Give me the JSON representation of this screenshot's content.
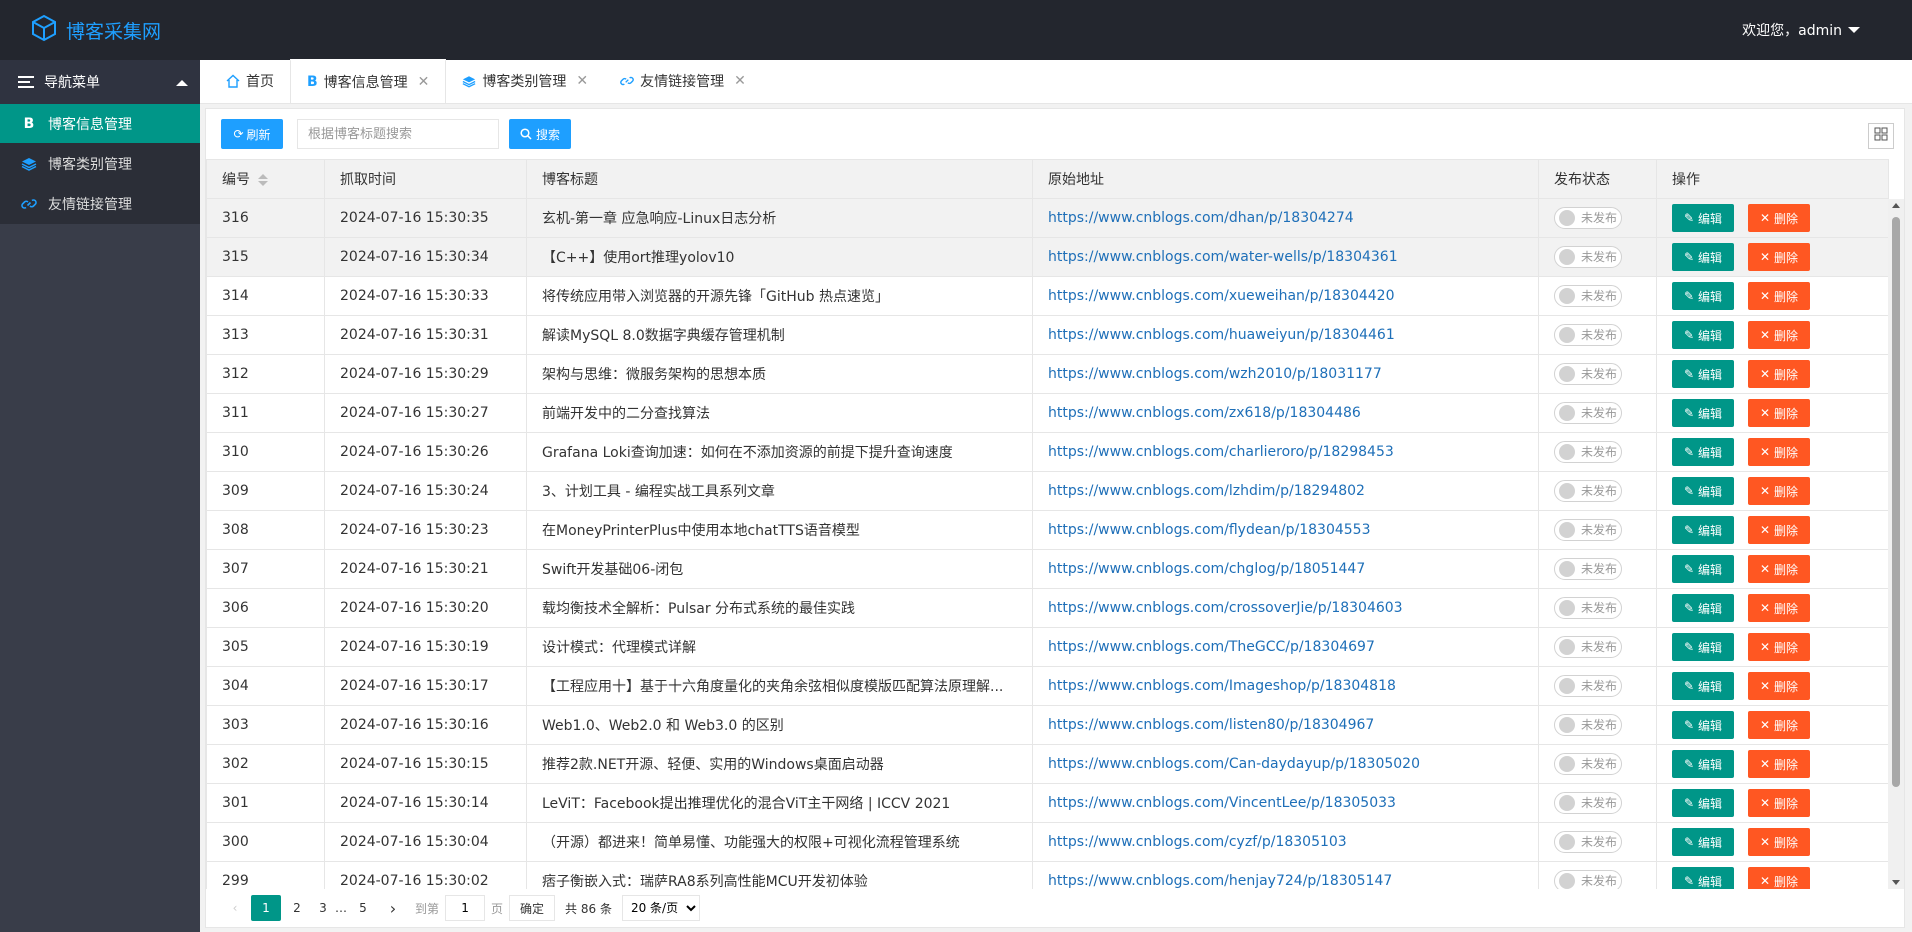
{
  "app": {
    "title": "博客采集网"
  },
  "user": {
    "greeting": "欢迎您，admin"
  },
  "sidebar": {
    "header": "导航菜单",
    "items": [
      {
        "icon": "b-letter-icon",
        "label": "博客信息管理",
        "active": true
      },
      {
        "icon": "layers-icon",
        "label": "博客类别管理",
        "active": false
      },
      {
        "icon": "link-icon",
        "label": "友情链接管理",
        "active": false
      }
    ]
  },
  "tabs": [
    {
      "label": "首页",
      "closable": false
    },
    {
      "label": "博客信息管理",
      "closable": true,
      "active": true
    },
    {
      "label": "博客类别管理",
      "closable": true
    },
    {
      "label": "友情链接管理",
      "closable": true
    }
  ],
  "toolbar": {
    "refresh_label": "刷新",
    "search_placeholder": "根据博客标题搜索",
    "search_label": "搜索"
  },
  "table": {
    "columns": [
      "编号",
      "抓取时间",
      "博客标题",
      "原始地址",
      "发布状态",
      "操作"
    ],
    "status_label": "未发布",
    "edit_label": "编辑",
    "delete_label": "删除",
    "rows": [
      [
        "316",
        "2024-07-16 15:30:35",
        "玄机-第一章 应急响应-Linux日志分析",
        "https://www.cnblogs.com/dhan/p/18304274"
      ],
      [
        "315",
        "2024-07-16 15:30:34",
        "【C++】使用ort推理yolov10",
        "https://www.cnblogs.com/water-wells/p/18304361"
      ],
      [
        "314",
        "2024-07-16 15:30:33",
        "将传统应用带入浏览器的开源先锋「GitHub 热点速览」",
        "https://www.cnblogs.com/xueweihan/p/18304420"
      ],
      [
        "313",
        "2024-07-16 15:30:31",
        "解读MySQL 8.0数据字典缓存管理机制",
        "https://www.cnblogs.com/huaweiyun/p/18304461"
      ],
      [
        "312",
        "2024-07-16 15:30:29",
        "架构与思维：微服务架构的思想本质",
        "https://www.cnblogs.com/wzh2010/p/18031177"
      ],
      [
        "311",
        "2024-07-16 15:30:27",
        "前端开发中的二分查找算法",
        "https://www.cnblogs.com/zx618/p/18304486"
      ],
      [
        "310",
        "2024-07-16 15:30:26",
        "Grafana Loki查询加速：如何在不添加资源的前提下提升查询速度",
        "https://www.cnblogs.com/charlieroro/p/18298453"
      ],
      [
        "309",
        "2024-07-16 15:30:24",
        "3、计划工具 - 编程实战工具系列文章",
        "https://www.cnblogs.com/lzhdim/p/18294802"
      ],
      [
        "308",
        "2024-07-16 15:30:23",
        "在MoneyPrinterPlus中使用本地chatTTS语音模型",
        "https://www.cnblogs.com/flydean/p/18304553"
      ],
      [
        "307",
        "2024-07-16 15:30:21",
        "Swift开发基础06-闭包",
        "https://www.cnblogs.com/chglog/p/18051447"
      ],
      [
        "306",
        "2024-07-16 15:30:20",
        "载均衡技术全解析：Pulsar 分布式系统的最佳实践",
        "https://www.cnblogs.com/crossoverJie/p/18304603"
      ],
      [
        "305",
        "2024-07-16 15:30:19",
        "设计模式：代理模式详解",
        "https://www.cnblogs.com/TheGCC/p/18304697"
      ],
      [
        "304",
        "2024-07-16 15:30:17",
        "【工程应用十】基于十六角度量化的夹角余弦相似度模版匹配算法原理解...",
        "https://www.cnblogs.com/Imageshop/p/18304818"
      ],
      [
        "303",
        "2024-07-16 15:30:16",
        "Web1.0、Web2.0 和 Web3.0 的区别",
        "https://www.cnblogs.com/listen80/p/18304967"
      ],
      [
        "302",
        "2024-07-16 15:30:15",
        "推荐2款.NET开源、轻便、实用的Windows桌面启动器",
        "https://www.cnblogs.com/Can-daydayup/p/18305020"
      ],
      [
        "301",
        "2024-07-16 15:30:14",
        "LeViT：Facebook提出推理优化的混合ViT主干网络 | ICCV 2021",
        "https://www.cnblogs.com/VincentLee/p/18305033"
      ],
      [
        "300",
        "2024-07-16 15:30:04",
        "（开源）都进来！简单易懂、功能强大的权限+可视化流程管理系统",
        "https://www.cnblogs.com/cyzf/p/18305103"
      ],
      [
        "299",
        "2024-07-16 15:30:02",
        "痞子衡嵌入式：瑞萨RA8系列高性能MCU开发初体验",
        "https://www.cnblogs.com/henjay724/p/18305147"
      ]
    ]
  },
  "pager": {
    "prev": "‹",
    "pages": [
      "1",
      "2",
      "3",
      "…",
      "5"
    ],
    "next": "›",
    "goto_label": "到第",
    "goto_value": "1",
    "page_unit": "页",
    "confirm_label": "确定",
    "total_label": "共 86 条",
    "page_size": "20 条/页"
  },
  "colors": {
    "header_bg": "#23262e",
    "sidebar_bg": "#393d49",
    "accent_green": "#009688",
    "accent_blue": "#1e9fff",
    "danger_orange": "#ff5722"
  }
}
